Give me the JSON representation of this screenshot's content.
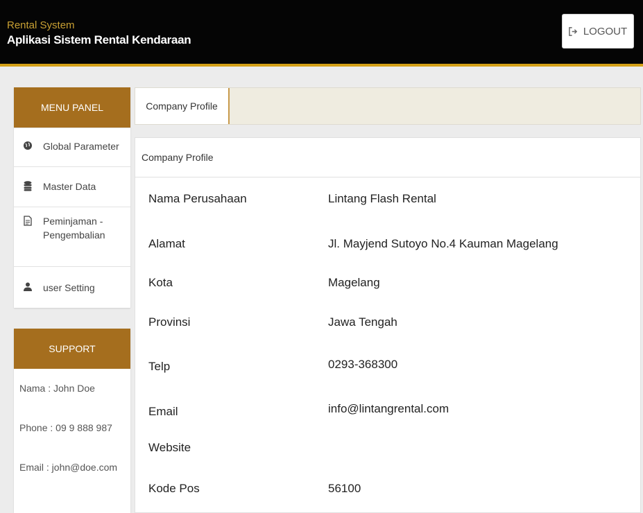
{
  "header": {
    "brand_small": "Rental System",
    "brand_title": "Aplikasi Sistem Rental Kendaraan",
    "logout_label": "LOGOUT",
    "logout_icon": "sign-out-icon"
  },
  "sidebar": {
    "menu_title": "MENU PANEL",
    "items": [
      {
        "label": "Global Parameter",
        "icon": "globe-icon"
      },
      {
        "label": "Master Data",
        "icon": "database-icon"
      },
      {
        "label": "Peminjaman -\nPengembalian",
        "label_line1": "Peminjaman -",
        "label_line2": "Pengembalian",
        "icon": "file-icon"
      },
      {
        "label": "user Setting",
        "icon": "users-icon"
      }
    ],
    "support_title": "SUPPORT",
    "support": {
      "name": "Nama : John Doe",
      "phone": "Phone : 09 9 888 987",
      "email": "Email : john@doe.com"
    }
  },
  "tabs": [
    {
      "label": "Company Profile",
      "active": true
    }
  ],
  "card": {
    "title": "Company Profile",
    "rows": [
      {
        "label": "Nama Perusahaan",
        "value": "Lintang Flash Rental"
      },
      {
        "label": "Alamat",
        "value": "Jl. Mayjend Sutoyo No.4 Kauman Magelang"
      },
      {
        "label": "Kota",
        "value": "Magelang"
      },
      {
        "label": "Provinsi",
        "value": "Jawa Tengah"
      },
      {
        "label": "Telp",
        "value": "0293-368300"
      },
      {
        "label": "Email",
        "value": "info@lintangrental.com"
      },
      {
        "label": "Website",
        "value": ""
      },
      {
        "label": "Kode Pos",
        "value": "56100"
      }
    ]
  },
  "colors": {
    "topbar": "#050505",
    "accent_gold": "#d4a017",
    "panel_brown": "#a56e1e",
    "brand_small": "#c8a033"
  }
}
